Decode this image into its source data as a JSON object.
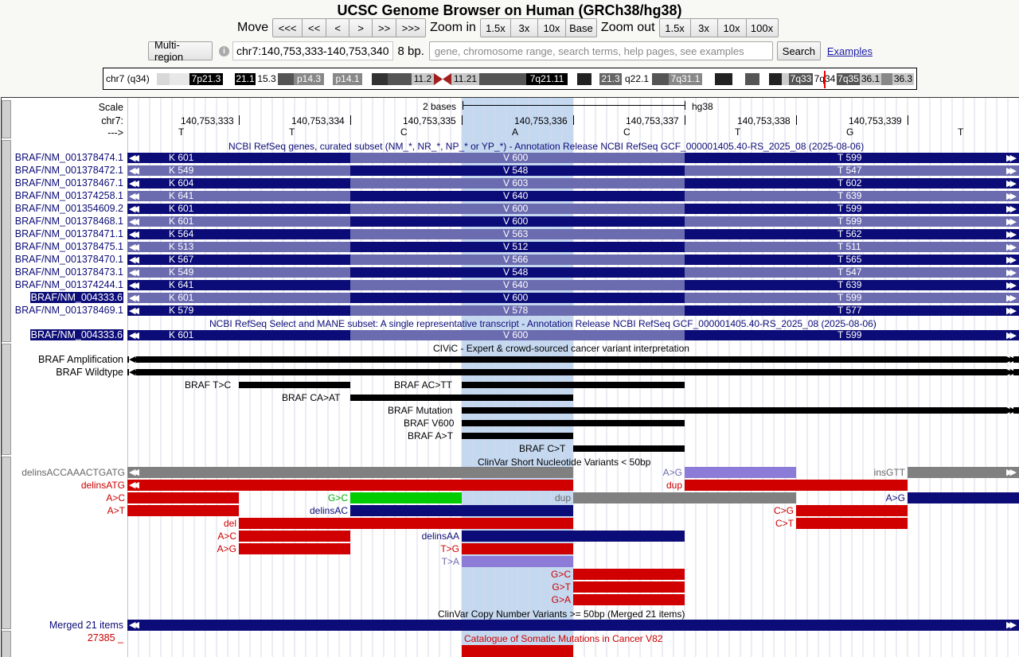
{
  "page_title": "UCSC Genome Browser on Human (GRCh38/hg38)",
  "nav": {
    "move_label": "Move",
    "move_buttons": [
      "<<<",
      "<<",
      "<",
      ">",
      ">>",
      ">>>"
    ],
    "zoom_in_label": "Zoom in",
    "zoom_in_buttons": [
      "1.5x",
      "3x",
      "10x",
      "Base"
    ],
    "zoom_out_label": "Zoom out",
    "zoom_out_buttons": [
      "1.5x",
      "3x",
      "10x",
      "100x"
    ]
  },
  "search": {
    "multi_region_label": "Multi-region",
    "info_icon_glyph": "i",
    "position_value": "chr7:140,753,333-140,753,340",
    "span_text": "8 bp.",
    "placeholder": "gene, chromosome range, search terms, help pages, see examples",
    "search_label": "Search",
    "examples_label": "Examples"
  },
  "ideogram": {
    "chrom_label": "chr7 (q34)",
    "bands": [
      "7p21.3",
      "21.1",
      "15.3",
      "p14.3",
      "p14.1",
      "11.2",
      "11.21",
      "7q21.11",
      "21.3",
      "q22.1",
      "7q31.1",
      "7q33",
      "7q34",
      "7q35",
      "36.1",
      "36.3"
    ]
  },
  "ruler": {
    "scale_label": "Scale",
    "chrom_label": "chr7:",
    "strand_label": "--->",
    "scale_text": "2 bases",
    "assembly": "hg38",
    "positions": [
      "140,753,333",
      "140,753,334",
      "140,753,335",
      "140,753,336",
      "140,753,337",
      "140,753,338",
      "140,753,339"
    ],
    "bases": [
      "T",
      "T",
      "C",
      "A",
      "C",
      "T",
      "G",
      "T"
    ]
  },
  "tracks": {
    "refseq_curated": {
      "title": "NCBI RefSeq genes, curated subset (NM_*, NR_*, NP_* or YP_*) - Annotation Release NCBI RefSeq GCF_000001405.40-RS_2025_08 (2025-08-06)",
      "rows": [
        {
          "name": "BRAF/NM_001378474.1",
          "codons": [
            "K 601",
            "V 600",
            "T 599"
          ]
        },
        {
          "name": "BRAF/NM_001378472.1",
          "codons": [
            "K 549",
            "V 548",
            "T 547"
          ]
        },
        {
          "name": "BRAF/NM_001378467.1",
          "codons": [
            "K 604",
            "V 603",
            "T 602"
          ]
        },
        {
          "name": "BRAF/NM_001374258.1",
          "codons": [
            "K 641",
            "V 640",
            "T 639"
          ]
        },
        {
          "name": "BRAF/NM_001354609.2",
          "codons": [
            "K 601",
            "V 600",
            "T 599"
          ]
        },
        {
          "name": "BRAF/NM_001378468.1",
          "codons": [
            "K 601",
            "V 600",
            "T 599"
          ]
        },
        {
          "name": "BRAF/NM_001378471.1",
          "codons": [
            "K 564",
            "V 563",
            "T 562"
          ]
        },
        {
          "name": "BRAF/NM_001378475.1",
          "codons": [
            "K 513",
            "V 512",
            "T 511"
          ]
        },
        {
          "name": "BRAF/NM_001378470.1",
          "codons": [
            "K 567",
            "V 566",
            "T 565"
          ]
        },
        {
          "name": "BRAF/NM_001378473.1",
          "codons": [
            "K 549",
            "V 548",
            "T 547"
          ]
        },
        {
          "name": "BRAF/NM_001374244.1",
          "codons": [
            "K 641",
            "V 640",
            "T 639"
          ]
        },
        {
          "name": "BRAF/NM_004333.6",
          "codons": [
            "K 601",
            "V 600",
            "T 599"
          ]
        },
        {
          "name": "BRAF/NM_001378469.1",
          "codons": [
            "K 579",
            "V 578",
            "T 577"
          ]
        }
      ]
    },
    "refseq_select": {
      "title": "NCBI RefSeq Select and MANE subset: A single representative transcript - Annotation Release NCBI RefSeq GCF_000001405.40-RS_2025_08 (2025-08-06)",
      "rows": [
        {
          "name": "BRAF/NM_004333.6",
          "codons": [
            "K 601",
            "V 600",
            "T 599"
          ]
        }
      ]
    },
    "civic": {
      "title": "CIViC - Expert & crowd-sourced cancer variant interpretation",
      "items": [
        "BRAF Amplification",
        "BRAF Wildtype",
        "BRAF T>C",
        "BRAF CA>AT",
        "BRAF AC>TT",
        "BRAF Mutation",
        "BRAF V600",
        "BRAF A>T",
        "BRAF C>T"
      ]
    },
    "clinvar_short": {
      "title": "ClinVar Short Nucleotide Variants < 50bp",
      "items": [
        "delinsACCAAACTGATG",
        "A>G",
        "insGTT",
        "delinsATG",
        "dup",
        "A>C",
        "G>C",
        "dup",
        "A>G",
        "A>T",
        "delinsAC",
        "C>G",
        "del",
        "C>T",
        "A>C",
        "delinsAA",
        "A>G",
        "T>G",
        "T>A",
        "G>C",
        "G>T",
        "G>A"
      ]
    },
    "clinvar_cnv": {
      "title": "ClinVar Copy Number Variants >= 50bp (Merged 21 items)",
      "items": [
        "Merged 21 items"
      ]
    },
    "cosmic": {
      "title": "Catalogue of Somatic Mutations in Cancer V82",
      "items": [
        "27385 _"
      ]
    }
  },
  "colors": {
    "navy": "#0c0c78",
    "light_navy": "#6b6bb0",
    "red": "#d00000",
    "gray": "#808080",
    "green": "#00cc00",
    "lavender": "#8c7cd8",
    "highlight": "#c4d8f0"
  }
}
